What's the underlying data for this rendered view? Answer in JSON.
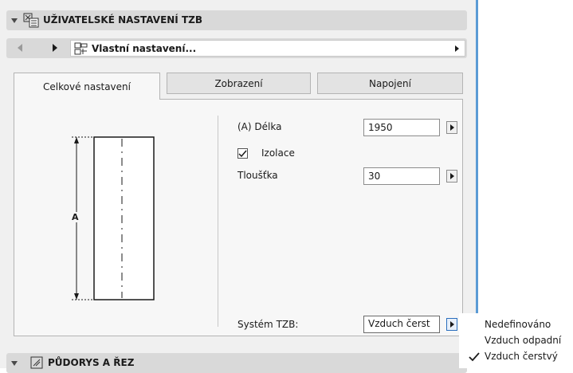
{
  "panel": {
    "section_title": "UŽIVATELSKÉ NASTAVENÍ TZB",
    "section2_title": "PŮDORYS A ŘEZ",
    "preset_label": "Vlastní nastavení..."
  },
  "tabs": [
    {
      "label": "Celkové nastavení",
      "active": true
    },
    {
      "label": "Zobrazení",
      "active": false
    },
    {
      "label": "Napojení",
      "active": false
    }
  ],
  "preview": {
    "dimension_label": "A"
  },
  "params": {
    "length_label": "(A) Délka",
    "length_value": "1950",
    "insulation_label": "Izolace",
    "insulation_checked": true,
    "thickness_label": "Tloušťka",
    "thickness_value": "30",
    "system_label": "Systém TZB:",
    "system_value": "Vzduch čerst"
  },
  "dropdown": {
    "options": [
      {
        "label": "Nedefinováno",
        "selected": false
      },
      {
        "label": "Vzduch odpadní",
        "selected": false
      },
      {
        "label": "Vzduch čerstvý",
        "selected": true
      }
    ]
  },
  "icons": [
    "collapse-arrow-icon",
    "settings-table-icon",
    "back-arrow-icon",
    "forward-arrow-icon",
    "preset-icon",
    "menu-arrow-icon",
    "checkmark-icon",
    "floorplan-icon"
  ],
  "colors": {
    "accent_line": "#5b9bd5",
    "header_bg": "#d9d9d9",
    "panel_bg": "#f0f0f0"
  }
}
